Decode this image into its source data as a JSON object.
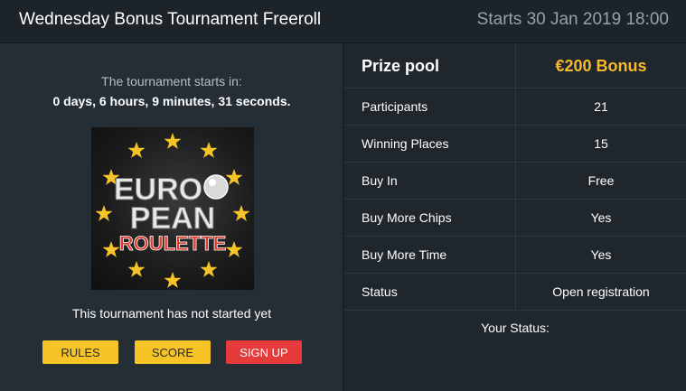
{
  "header": {
    "title": "Wednesday Bonus Tournament Freeroll",
    "starts": "Starts 30 Jan 2019 18:00"
  },
  "left": {
    "countdown_label": "The tournament starts in:",
    "countdown_value": "0 days, 6 hours, 9 minutes, 31 seconds.",
    "logo": {
      "line1": "EURO",
      "line2": "PEAN",
      "line3": "ROULETTE"
    },
    "status_text": "This tournament has not started yet",
    "buttons": {
      "rules": "RULES",
      "score": "SCORE",
      "signup": "SIGN UP"
    }
  },
  "table": {
    "prize_pool_label": "Prize pool",
    "prize_pool_value": "€200 Bonus",
    "rows": [
      {
        "label": "Participants",
        "value": "21"
      },
      {
        "label": "Winning Places",
        "value": "15"
      },
      {
        "label": "Buy In",
        "value": "Free"
      },
      {
        "label": "Buy More Chips",
        "value": "Yes"
      },
      {
        "label": "Buy More Time",
        "value": "Yes"
      },
      {
        "label": "Status",
        "value": "Open registration"
      }
    ],
    "your_status": "Your Status:"
  },
  "colors": {
    "accent_yellow": "#f7c427",
    "accent_red": "#e53b3b",
    "prize_gold": "#f7b928"
  }
}
